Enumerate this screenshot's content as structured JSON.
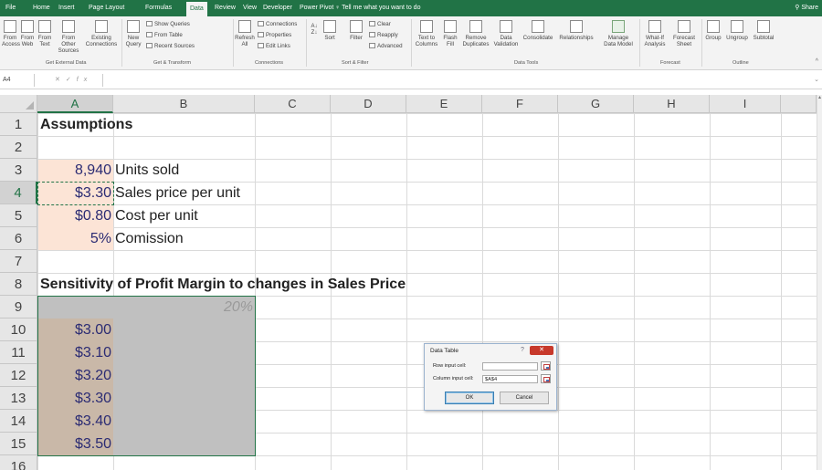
{
  "ribbon": {
    "tabs": [
      "File",
      "Home",
      "Insert",
      "Page Layout",
      "Formulas",
      "Data",
      "Review",
      "View",
      "Developer",
      "Power Pivot"
    ],
    "active_tab": "Data",
    "tell_me": "Tell me what you want to do",
    "share": "Share",
    "get_external": {
      "from_access": "From\nAccess",
      "from_web": "From\nWeb",
      "from_text": "From\nText",
      "from_other": "From Other\nSources",
      "existing": "Existing\nConnections",
      "group_label": "Get External Data"
    },
    "get_transform": {
      "new_query": "New\nQuery",
      "show_queries": "Show Queries",
      "from_table": "From Table",
      "recent_sources": "Recent Sources",
      "group_label": "Get & Transform"
    },
    "connections": {
      "refresh_all": "Refresh\nAll",
      "connections": "Connections",
      "properties": "Properties",
      "edit_links": "Edit Links",
      "group_label": "Connections"
    },
    "sort_filter": {
      "sort": "Sort",
      "filter": "Filter",
      "clear": "Clear",
      "reapply": "Reapply",
      "advanced": "Advanced",
      "group_label": "Sort & Filter"
    },
    "data_tools": {
      "text_to_columns": "Text to\nColumns",
      "flash_fill": "Flash\nFill",
      "remove_duplicates": "Remove\nDuplicates",
      "data_validation": "Data\nValidation",
      "consolidate": "Consolidate",
      "relationships": "Relationships",
      "manage_data_model": "Manage\nData Model",
      "group_label": "Data Tools"
    },
    "forecast": {
      "what_if": "What-If\nAnalysis",
      "forecast_sheet": "Forecast\nSheet",
      "group_label": "Forecast"
    },
    "outline": {
      "group": "Group",
      "ungroup": "Ungroup",
      "subtotal": "Subtotal",
      "group_label": "Outline"
    }
  },
  "formula_bar": {
    "name_box": "A4",
    "fx": "fx",
    "formula": ""
  },
  "sheet": {
    "columns": [
      "A",
      "B",
      "C",
      "D",
      "E",
      "F",
      "G",
      "H",
      "I"
    ],
    "rows": [
      "1",
      "2",
      "3",
      "4",
      "5",
      "6",
      "7",
      "8",
      "9",
      "10",
      "11",
      "12",
      "13",
      "14",
      "15",
      "16"
    ],
    "selected_column": "A",
    "cells": {
      "A1": "Assumptions",
      "A3": "8,940",
      "B3": "Units sold",
      "A4": "$3.30",
      "B4": "Sales price per unit",
      "A5": "$0.80",
      "B5": "Cost per unit",
      "A6": "5%",
      "B6": "Comission",
      "A8": "Sensitivity of Profit Margin to changes in Sales Price",
      "B9": "20%",
      "A10": "$3.00",
      "A11": "$3.10",
      "A12": "$3.20",
      "A13": "$3.30",
      "A14": "$3.40",
      "A15": "$3.50"
    }
  },
  "dialog": {
    "title": "Data Table",
    "help": "?",
    "close": "✕",
    "row_input_label": "Row input cell:",
    "row_input_value": "",
    "column_input_label": "Column input cell:",
    "column_input_value": "$A$4",
    "ok": "OK",
    "cancel": "Cancel"
  },
  "colors": {
    "accent": "#217346",
    "assumption_fill": "#fce4d6",
    "price_fill": "#c9b8a8",
    "selection_fill": "#c0c0c0"
  }
}
